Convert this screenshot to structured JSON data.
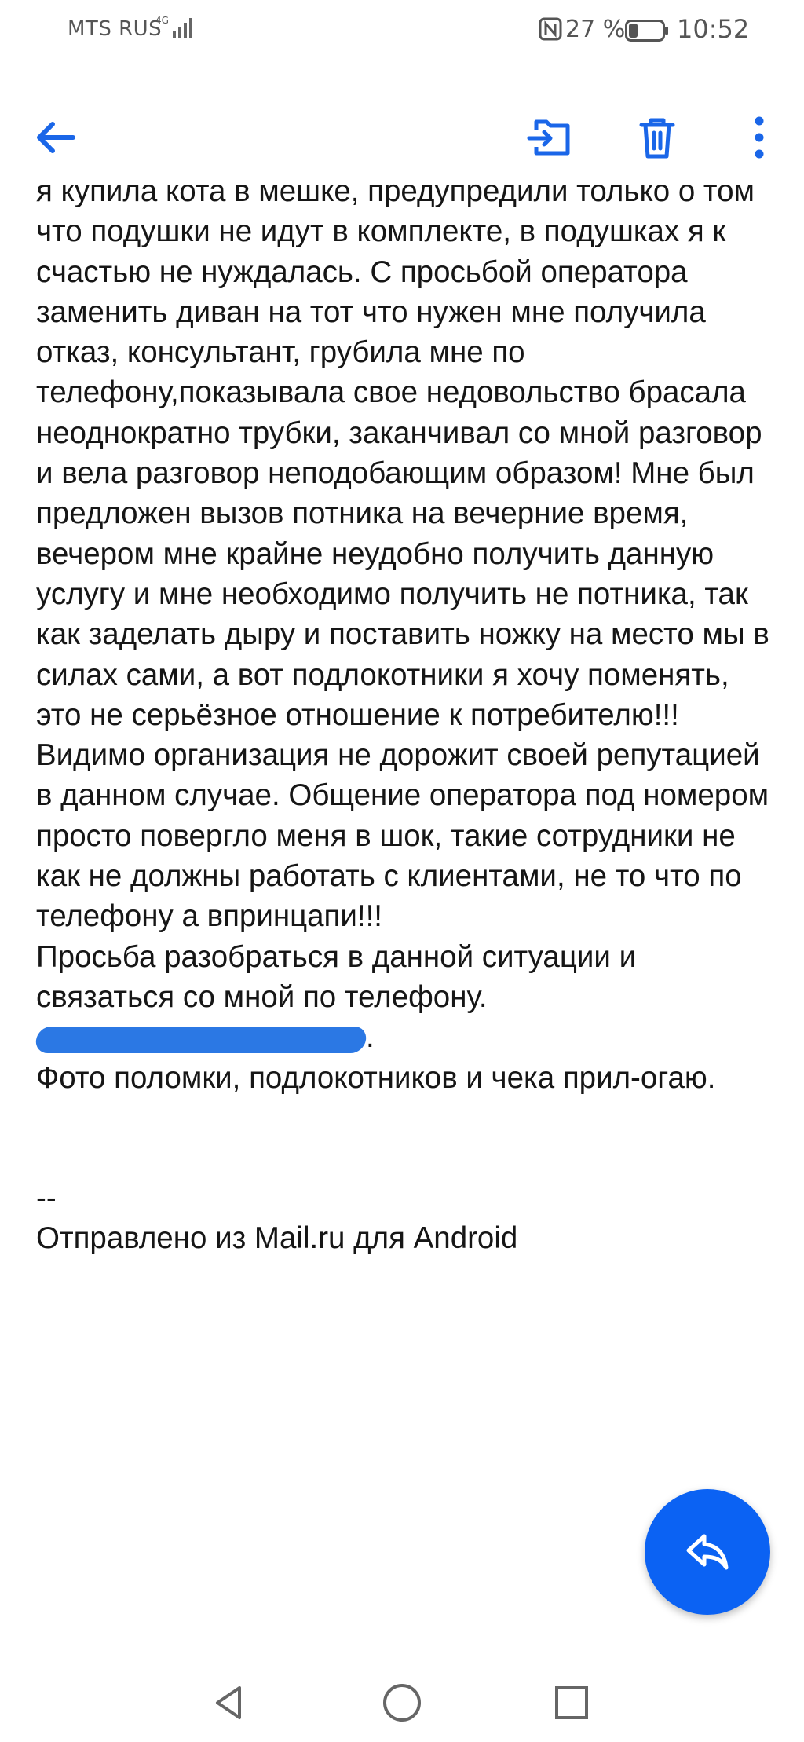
{
  "status_bar": {
    "carrier": "MTS RUS",
    "network": "4G",
    "battery_percent": "27 %",
    "battery_level": 0.27,
    "time": "10:52"
  },
  "toolbar": {
    "back_icon": "arrow-left-icon",
    "move_icon": "move-to-folder-icon",
    "delete_icon": "trash-icon",
    "more_icon": "more-vertical-icon",
    "accent_color": "#1a66e8"
  },
  "mail": {
    "paragraph_1": "я купила кота в мешке, предупредили только о том что подушки не идут в комплекте, в подушках я к счастью не нуждалась. С просьбой оператора заменить диван на тот что нужен мне получила отказ, консультант, грубила мне по телефону,показывала свое недовольство брасала неоднократно трубки, заканчивал со мной разговор и вела разговор неподобающим образом! Мне был предложен вызов потника на вечерние время, вечером мне крайне неудобно получить данную услугу и мне необходимо получить не потника, так как заделать дыру и поставить ножку на место мы в силах сами, а вот подлокотники я хочу поменять, это не серьёзное отношение к потребителю!!! Видимо организация не дорожит своей репутацией в данном случае. Общение оператора под номером просто повергло меня в шок, такие сотрудники не как не должны работать с клиентами, не то что по телефону а впринцапи!!!",
    "paragraph_2": "Просьба разобраться в данной ситуации и связаться со мной по телефону.",
    "redacted_suffix": ".",
    "paragraph_3": "Фото поломки, подлокотников и чека прил-огаю.",
    "signature_dash": "--",
    "signature": "Отправлено из Mail.ru для Android"
  },
  "fab": {
    "icon": "reply-icon",
    "color": "#0b62f3"
  },
  "nav": {
    "back_icon": "nav-back-triangle-icon",
    "home_icon": "nav-home-circle-icon",
    "recent_icon": "nav-recent-square-icon"
  }
}
